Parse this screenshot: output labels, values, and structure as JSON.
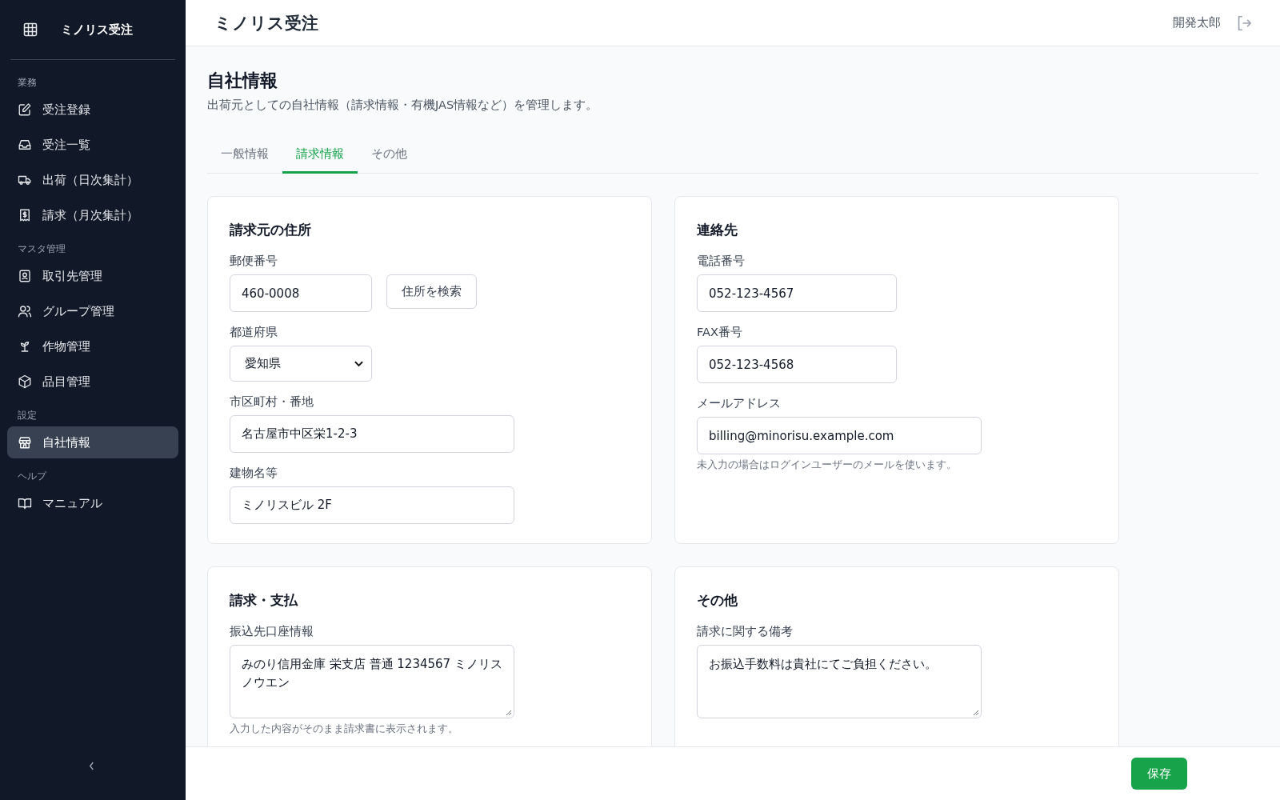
{
  "app": {
    "name": "ミノリス受注"
  },
  "sidebar": {
    "sections": [
      {
        "heading": "業務",
        "items": [
          {
            "label": "受注登録",
            "selected": false
          },
          {
            "label": "受注一覧",
            "selected": false
          },
          {
            "label": "出荷（日次集計）",
            "selected": false
          },
          {
            "label": "請求（月次集計）",
            "selected": false
          }
        ]
      },
      {
        "heading": "マスタ管理",
        "items": [
          {
            "label": "取引先管理",
            "selected": false
          },
          {
            "label": "グループ管理",
            "selected": false
          },
          {
            "label": "作物管理",
            "selected": false
          },
          {
            "label": "品目管理",
            "selected": false
          }
        ]
      },
      {
        "heading": "設定",
        "items": [
          {
            "label": "自社情報",
            "selected": true
          }
        ]
      },
      {
        "heading": "ヘルプ",
        "items": [
          {
            "label": "マニュアル",
            "selected": false
          }
        ]
      }
    ]
  },
  "header": {
    "title": "ミノリス受注",
    "user": "開発太郎"
  },
  "page": {
    "title": "自社情報",
    "description": "出荷元としての自社情報（請求情報・有機JAS情報など）を管理します。"
  },
  "tabs": [
    {
      "label": "一般情報",
      "selected": false
    },
    {
      "label": "請求情報",
      "selected": true
    },
    {
      "label": "その他",
      "selected": false
    }
  ],
  "cards": [
    {
      "title": "請求元の住所",
      "fields": [
        {
          "kind": "input",
          "label": "郵便番号",
          "value": "460-0008",
          "button": "住所を検索"
        },
        {
          "kind": "select",
          "label": "都道府県",
          "value": "愛知県"
        },
        {
          "kind": "input",
          "label": "市区町村・番地",
          "value": "名古屋市中区栄1-2-3"
        },
        {
          "kind": "input",
          "label": "建物名等",
          "value": "ミノリスビル 2F"
        }
      ]
    },
    {
      "title": "連絡先",
      "fields": [
        {
          "kind": "input",
          "label": "電話番号",
          "value": "052-123-4567"
        },
        {
          "kind": "input",
          "label": "FAX番号",
          "value": "052-123-4568"
        },
        {
          "kind": "input",
          "label": "メールアドレス",
          "value": "billing@minorisu.example.com",
          "hint": "未入力の場合はログインユーザーのメールを使います。"
        }
      ]
    },
    {
      "title": "請求・支払",
      "fields": [
        {
          "kind": "textarea",
          "label": "振込先口座情報",
          "value": "みのり信用金庫 栄支店 普通 1234567 ミノリスノウエン",
          "hint": "入力した内容がそのまま請求書に表示されます。"
        }
      ]
    },
    {
      "title": "その他",
      "fields": [
        {
          "kind": "textarea",
          "label": "請求に関する備考",
          "value": "お振込手数料は貴社にてご負担ください。"
        }
      ]
    }
  ],
  "footer": {
    "save": "保存"
  }
}
